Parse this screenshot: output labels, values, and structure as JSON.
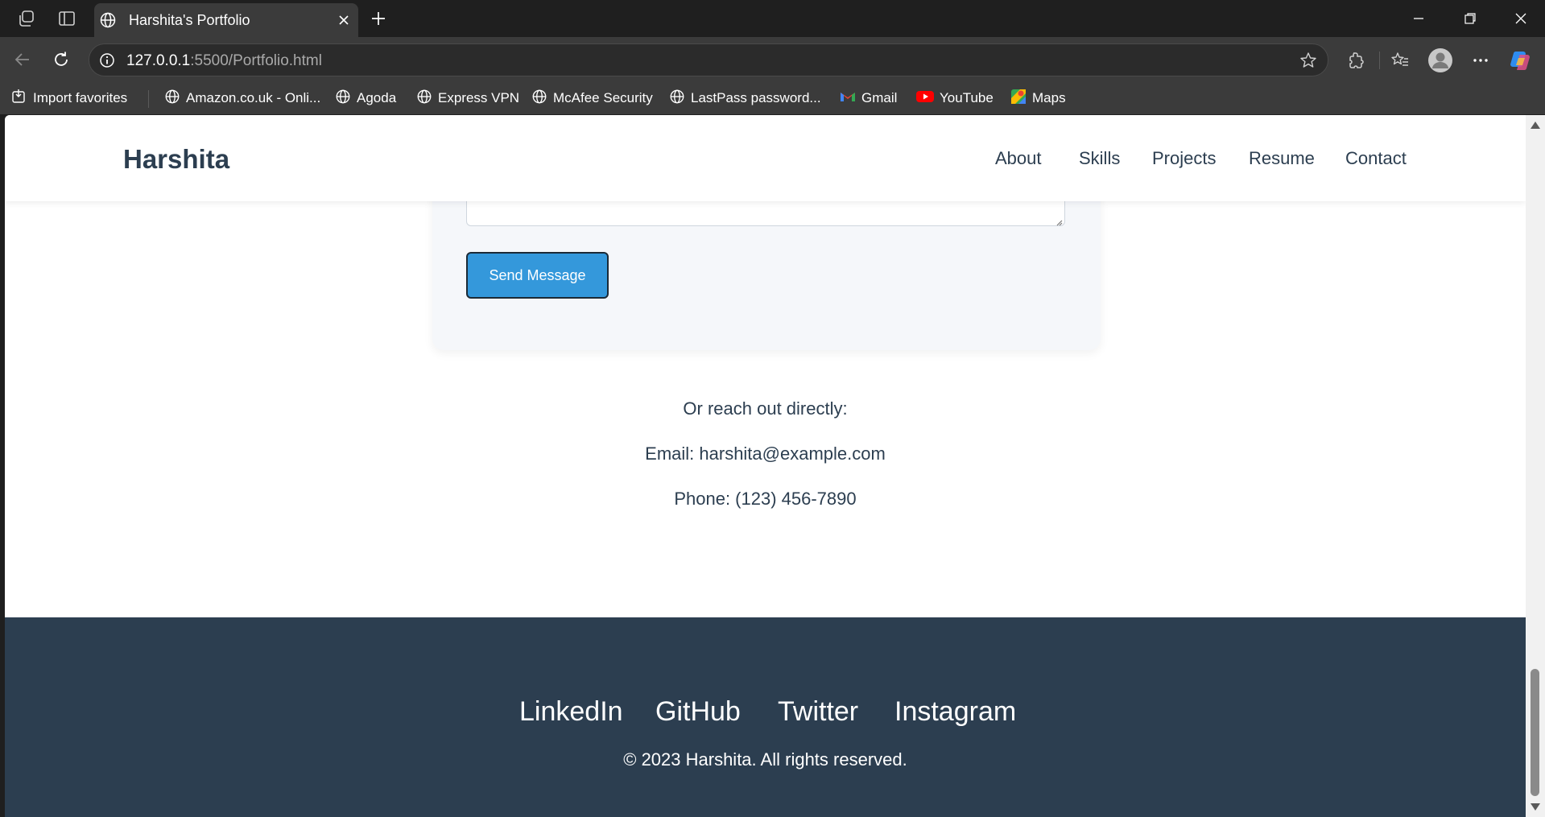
{
  "browser": {
    "tab_title": "Harshita's Portfolio",
    "url_host": "127.0.0.1",
    "url_rest": ":5500/Portfolio.html",
    "bookmarks": [
      {
        "label": "Import favorites",
        "icon": "import-icon"
      },
      {
        "label": "Amazon.co.uk - Onli...",
        "icon": "globe-icon"
      },
      {
        "label": "Agoda",
        "icon": "globe-icon"
      },
      {
        "label": "Express VPN",
        "icon": "globe-icon"
      },
      {
        "label": "McAfee Security",
        "icon": "globe-icon"
      },
      {
        "label": "LastPass password...",
        "icon": "globe-icon"
      },
      {
        "label": "Gmail",
        "icon": "gmail-icon"
      },
      {
        "label": "YouTube",
        "icon": "youtube-icon"
      },
      {
        "label": "Maps",
        "icon": "maps-icon"
      }
    ]
  },
  "site": {
    "logo": "Harshita",
    "nav": [
      "About",
      "Skills",
      "Projects",
      "Resume",
      "Contact"
    ],
    "form": {
      "send_label": "Send Message"
    },
    "contact": {
      "intro": "Or reach out directly:",
      "email": "Email: harshita@example.com",
      "phone": "Phone: (123) 456-7890"
    },
    "footer": {
      "social": [
        "LinkedIn",
        "GitHub",
        "Twitter",
        "Instagram"
      ],
      "copyright": "© 2023 Harshita. All rights reserved."
    }
  },
  "colors": {
    "primary": "#3498db",
    "dark": "#2c3e50",
    "card_bg": "#f5f7fa"
  }
}
